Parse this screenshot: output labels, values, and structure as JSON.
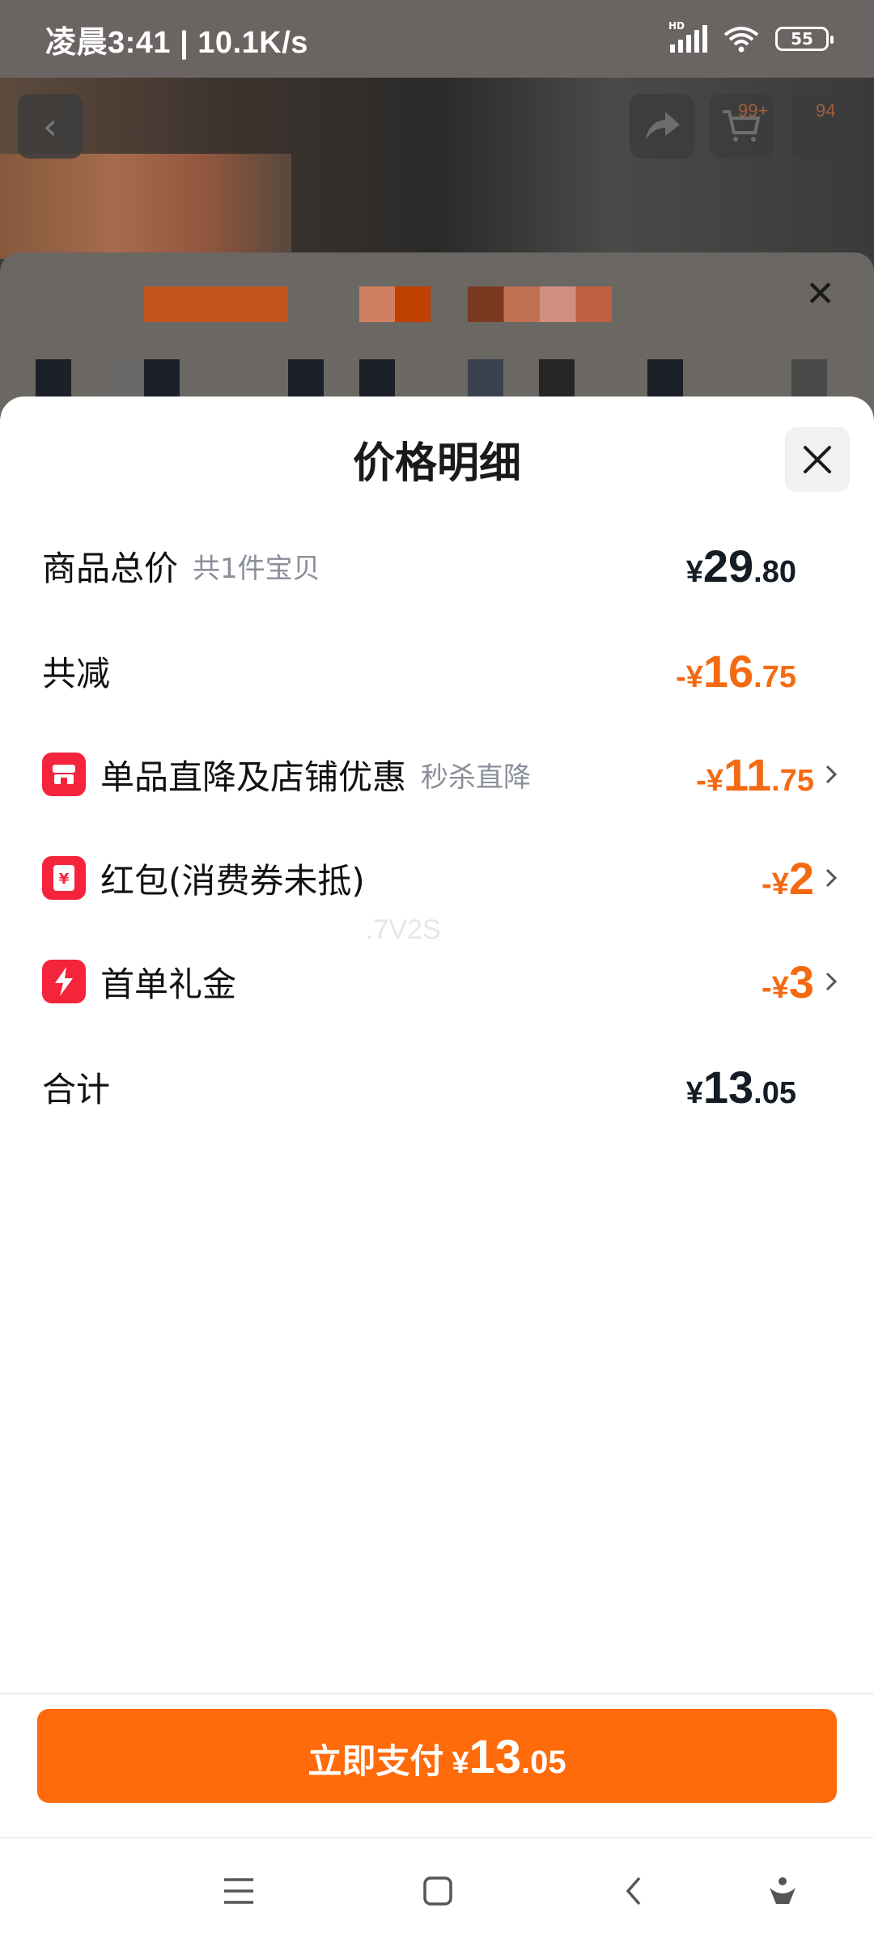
{
  "status_bar": {
    "time": "凌晨3:41 | 10.1K/s",
    "signal_label": "HD",
    "battery": "55"
  },
  "background": {
    "cart_badge": "99+",
    "msg_badge": "94"
  },
  "price_detail": {
    "title": "价格明细",
    "rows": [
      {
        "label": "商品总价",
        "sub": "共1件宝贝",
        "currency": "¥",
        "int": "29",
        "dec": ".80",
        "sign": ""
      },
      {
        "label": "共减",
        "sub": "",
        "currency": "¥",
        "int": "16",
        "dec": ".75",
        "sign": "-"
      },
      {
        "label": "单品直降及店铺优惠",
        "sub": "秒杀直降",
        "currency": "¥",
        "int": "11",
        "dec": ".75",
        "sign": "-",
        "icon": "store-icon"
      },
      {
        "label": "红包(消费券未抵)",
        "sub": "",
        "currency": "¥",
        "int": "2",
        "dec": "",
        "sign": "-",
        "icon": "red-packet-icon"
      },
      {
        "label": "首单礼金",
        "sub": "",
        "currency": "¥",
        "int": "3",
        "dec": "",
        "sign": "-",
        "icon": "lightning-icon"
      },
      {
        "label": "合计",
        "sub": "",
        "currency": "¥",
        "int": "13",
        "dec": ".05",
        "sign": ""
      }
    ],
    "watermark": ".7V2S"
  },
  "pay_button": {
    "label": "立即支付",
    "currency": "¥",
    "int": "13",
    "dec": ".05"
  },
  "colors": {
    "accent_orange": "#ff6a0a",
    "discount_orange": "#f46a12",
    "icon_red": "#f5243d"
  }
}
